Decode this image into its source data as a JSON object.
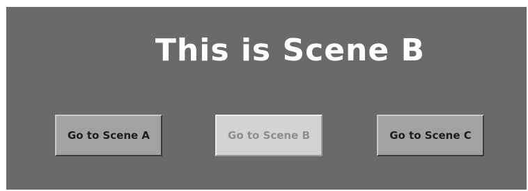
{
  "scene": {
    "title": "This is Scene B",
    "current": "B"
  },
  "buttons": [
    {
      "label": "Go to Scene A",
      "state": "enabled"
    },
    {
      "label": "Go to Scene B",
      "state": "disabled"
    },
    {
      "label": "Go to Scene C",
      "state": "enabled"
    }
  ],
  "colors": {
    "background": "#6a6a6d",
    "title_text": "#ffffff",
    "button_face": "#a2a2a4",
    "button_disabled_face": "#d3d3d4",
    "button_disabled_text": "#8e8e90"
  }
}
